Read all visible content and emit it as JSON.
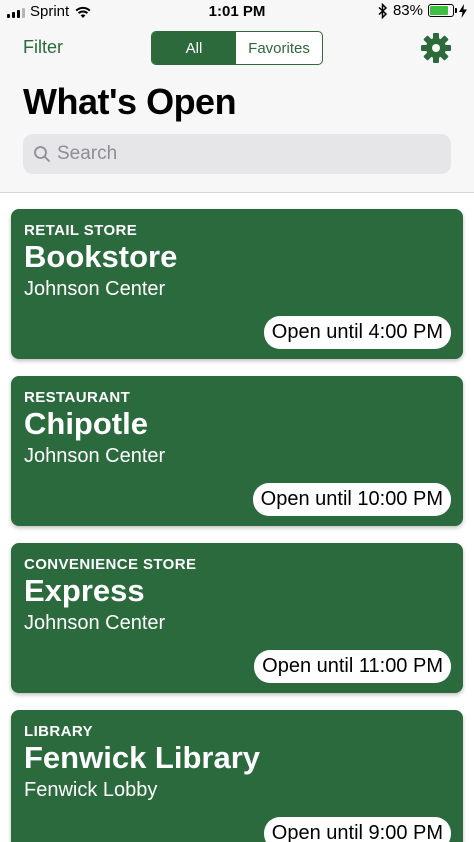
{
  "status_bar": {
    "carrier": "Sprint",
    "time": "1:01 PM",
    "battery_percent": "83%",
    "battery_level": 0.83,
    "icons": [
      "signal-bars-icon",
      "wifi-icon",
      "bluetooth-icon",
      "battery-icon",
      "charging-bolt-icon"
    ]
  },
  "header": {
    "filter_label": "Filter",
    "segments": [
      {
        "label": "All",
        "selected": true
      },
      {
        "label": "Favorites",
        "selected": false
      }
    ],
    "settings_icon": "gear-icon",
    "title": "What's Open",
    "search": {
      "placeholder": "Search",
      "value": "",
      "icon": "search-icon"
    }
  },
  "colors": {
    "accent": "#2c6a3b",
    "card_background": "#2a6a3c",
    "header_background": "#f7f7f7",
    "search_background": "#e6e6e9"
  },
  "places": [
    {
      "type": "RETAIL STORE",
      "name": "Bookstore",
      "location": "Johnson Center",
      "hours": "Open until 4:00 PM"
    },
    {
      "type": "RESTAURANT",
      "name": "Chipotle",
      "location": "Johnson Center",
      "hours": "Open until 10:00 PM"
    },
    {
      "type": "CONVENIENCE STORE",
      "name": "Express",
      "location": "Johnson Center",
      "hours": "Open until 11:00 PM"
    },
    {
      "type": "LIBRARY",
      "name": "Fenwick Library",
      "location": "Fenwick Lobby",
      "hours": "Open until 9:00 PM"
    }
  ]
}
